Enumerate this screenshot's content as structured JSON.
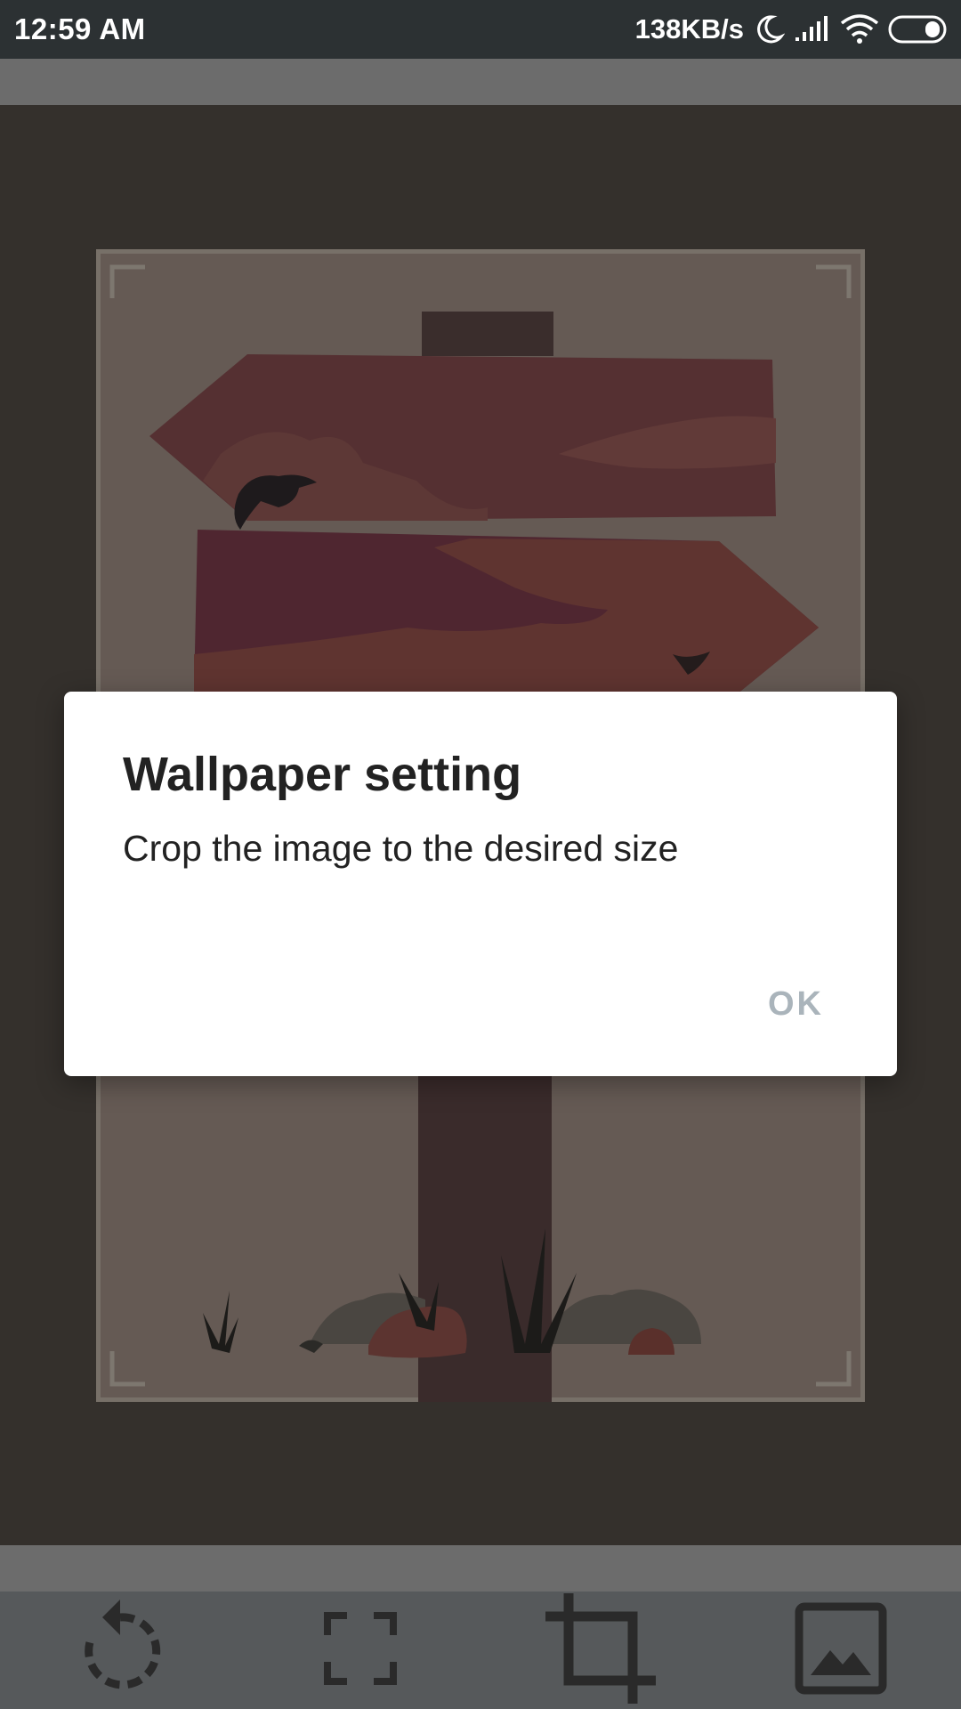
{
  "status_bar": {
    "time": "12:59 AM",
    "net_speed": "138KB/s",
    "icons": [
      "moon-icon",
      "signal-icon",
      "wifi-icon",
      "battery-icon"
    ]
  },
  "dialog": {
    "title": "Wallpaper setting",
    "message": "Crop the image to the desired size",
    "ok_label": "OK"
  },
  "toolbar": {
    "icons": [
      "rotate-icon",
      "fullscreen-icon",
      "crop-icon",
      "image-icon"
    ]
  },
  "colors": {
    "status_bar": "#2c3133",
    "canvas": "#34302c",
    "toolbar": "#56595b",
    "ok_text": "#aab4bb"
  }
}
